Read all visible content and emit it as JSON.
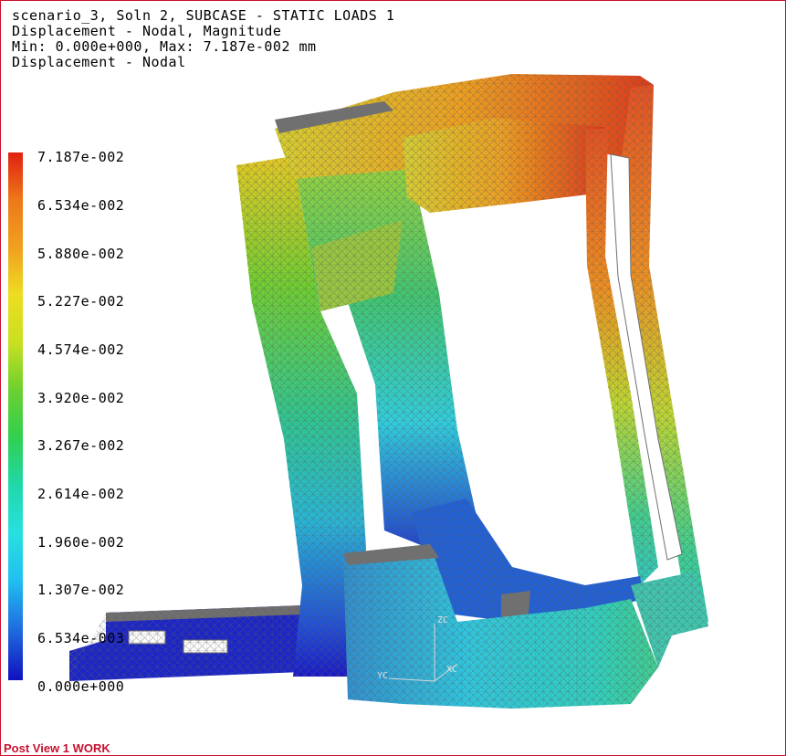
{
  "header": {
    "line1": "scenario_3, Soln 2, SUBCASE - STATIC LOADS 1",
    "line2": "Displacement - Nodal, Magnitude",
    "line3": "Min: 0.000e+000, Max: 7.187e-002 mm",
    "line4": "Displacement - Nodal"
  },
  "legend": {
    "labels": [
      "7.187e-002",
      "6.534e-002",
      "5.880e-002",
      "5.227e-002",
      "4.574e-002",
      "3.920e-002",
      "3.267e-002",
      "2.614e-002",
      "1.960e-002",
      "1.307e-002",
      "6.534e-003",
      "0.000e+000"
    ],
    "colors": [
      "#e02010",
      "#ee7818",
      "#f0a020",
      "#eedd20",
      "#c8e020",
      "#6cd030",
      "#30d050",
      "#20d8a8",
      "#28e0e0",
      "#20c0f0",
      "#2070e0",
      "#1010c0"
    ]
  },
  "triad": {
    "x_label": "XC",
    "y_label": "YC",
    "z_label": "ZC"
  },
  "status": {
    "text": "Post View  1 WORK"
  }
}
